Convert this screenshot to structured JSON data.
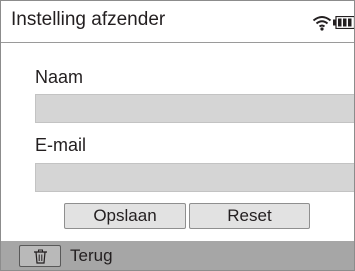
{
  "screen": {
    "title": "Instelling afzender",
    "status_icons": [
      "wifi-icon",
      "battery-icon"
    ]
  },
  "form": {
    "name_label": "Naam",
    "name_value": "",
    "email_label": "E-mail",
    "email_value": ""
  },
  "buttons": {
    "save_label": "Opslaan",
    "reset_label": "Reset"
  },
  "bottom_bar": {
    "back_label": "Terug",
    "back_icon": "trash-icon"
  },
  "colors": {
    "input_fill": "#d5d5d5",
    "button_fill": "#e2e2e2",
    "bottom_bar": "#a6a6a6",
    "text": "#231f20"
  }
}
